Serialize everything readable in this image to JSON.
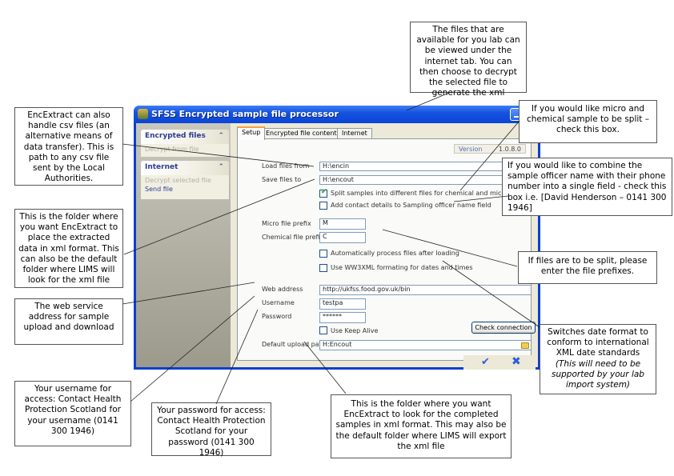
{
  "window": {
    "title": "SFSS Encrypted sample file processor"
  },
  "sidebar": {
    "groups": [
      {
        "title": "Encrypted files",
        "chevron": "⌃",
        "items": [
          {
            "label": "Decrypt from file",
            "enabled": false
          }
        ]
      },
      {
        "title": "Internet",
        "chevron": "⌃",
        "items": [
          {
            "label": "Decrypt selected file",
            "enabled": false
          },
          {
            "label": "Send file",
            "enabled": true
          }
        ]
      }
    ]
  },
  "tabs": [
    {
      "label": "Setup",
      "active": true
    },
    {
      "label": "Encrypted file contents",
      "active": false
    },
    {
      "label": "Internet",
      "active": false
    }
  ],
  "setup": {
    "version_label": "Version",
    "version_value": "1.0.8.0",
    "load_files_label": "Load files from",
    "load_files_value": "H:\\encin",
    "save_files_label": "Save files to",
    "save_files_value": "H:\\encout",
    "split_samples_label": "Split samples into different files for chemical and micro",
    "split_samples_checked": true,
    "add_contact_label": "Add contact details to Sampling officer name field",
    "add_contact_checked": false,
    "micro_prefix_label": "Micro file prefix",
    "micro_prefix_value": "M",
    "chemical_prefix_label": "Chemical file prefix",
    "chemical_prefix_value": "C",
    "auto_process_label": "Automatically process files after loading",
    "auto_process_checked": false,
    "w3_xml_label": "Use WW3XML formating for dates and times",
    "w3_xml_checked": false,
    "web_address_label": "Web address",
    "web_address_value": "http://ukfss.food.gov.uk/bin",
    "username_label": "Username",
    "username_value": "testpa",
    "password_label": "Password",
    "password_value": "******",
    "keep_alive_label": "Use Keep Alive",
    "keep_alive_checked": false,
    "check_connection_label": "Check connection",
    "default_upload_label": "Default upload path",
    "default_upload_value": "H:Encout",
    "ok_icon": "✔",
    "cancel_icon": "✖"
  },
  "callouts": {
    "internet_tab": "The files that are available for you lab can be viewed under the internet tab. You can then choose to decrypt the selected file to generate the xml",
    "csv": "EncExtract can also handle csv files (an alternative means of data transfer). This is path to any csv file sent by the Local Authorities.",
    "split": "If you would like micro and chemical sample to be split – check this box.",
    "combine": "If you would like to combine the sample officer name with their phone number into a single field - check this box i.e. [David Henderson – 0141 300 1946]",
    "save_folder": "This is the folder where you want EncExtract to place the extracted data in xml format. This can also be the default folder where LIMS will look for the xml file",
    "prefixes": "If files are to be split, please enter the file prefixes.",
    "web_service": "The web service address for sample upload and download",
    "date_format": "Switches date format to conform to international XML date standards",
    "date_format_note": "(This will need to be supported by your lab import system)",
    "username": "Your username for access: Contact Health Protection Scotland for your username (0141 300 1946)",
    "password": "Your password for access: Contact Health Protection Scotland for your password (0141 300 1946)",
    "upload_folder": "This is the folder where you want EncExtract to look for the completed samples in xml format. This may also be the default folder where LIMS will export the xml file"
  }
}
